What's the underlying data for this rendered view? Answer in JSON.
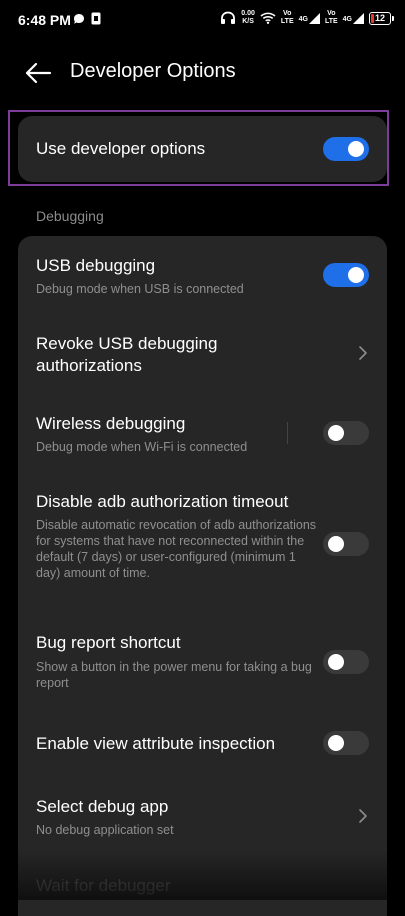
{
  "status_bar": {
    "time": "6:48 PM",
    "data_speed_value": "0.00",
    "data_speed_unit": "K/S",
    "sim1_top": "Vo",
    "sim1_bottom": "LTE",
    "sim1_net": "4G",
    "sim2_top": "Vo",
    "sim2_bottom": "LTE",
    "sim2_net": "4G",
    "battery": "12",
    "battery_color": "#e53935"
  },
  "header": {
    "title": "Developer Options"
  },
  "developer_toggle": {
    "label": "Use developer options",
    "state": "on"
  },
  "section": {
    "label": "Debugging"
  },
  "settings": {
    "items": [
      {
        "title": "USB debugging",
        "subtitle": "Debug mode when USB is connected",
        "control": "toggle",
        "state": "on"
      },
      {
        "title": "Revoke USB debugging authorizations",
        "subtitle": "",
        "control": "chevron"
      },
      {
        "title": "Wireless debugging",
        "subtitle": "Debug mode when Wi-Fi is connected",
        "control": "toggle",
        "state": "off"
      },
      {
        "title": "Disable adb authorization timeout",
        "subtitle": "Disable automatic revocation of adb authorizations for systems that have not reconnected within the default (7 days) or user-configured (minimum 1 day) amount of time.",
        "control": "toggle",
        "state": "off"
      },
      {
        "title": "Bug report shortcut",
        "subtitle": "Show a button in the power menu for taking a bug report",
        "control": "toggle",
        "state": "off"
      },
      {
        "title": "Enable view attribute inspection",
        "subtitle": "",
        "control": "toggle",
        "state": "off"
      },
      {
        "title": "Select debug app",
        "subtitle": "No debug application set",
        "control": "chevron"
      },
      {
        "title": "Wait for debugger",
        "subtitle": "",
        "control": "none"
      }
    ]
  },
  "colors": {
    "accent": "#1e6fe8",
    "highlight": "#7d3c98",
    "card": "#262626",
    "background": "#000000"
  },
  "icons": {
    "back": "arrow-left",
    "chevron": "chevron-right"
  }
}
